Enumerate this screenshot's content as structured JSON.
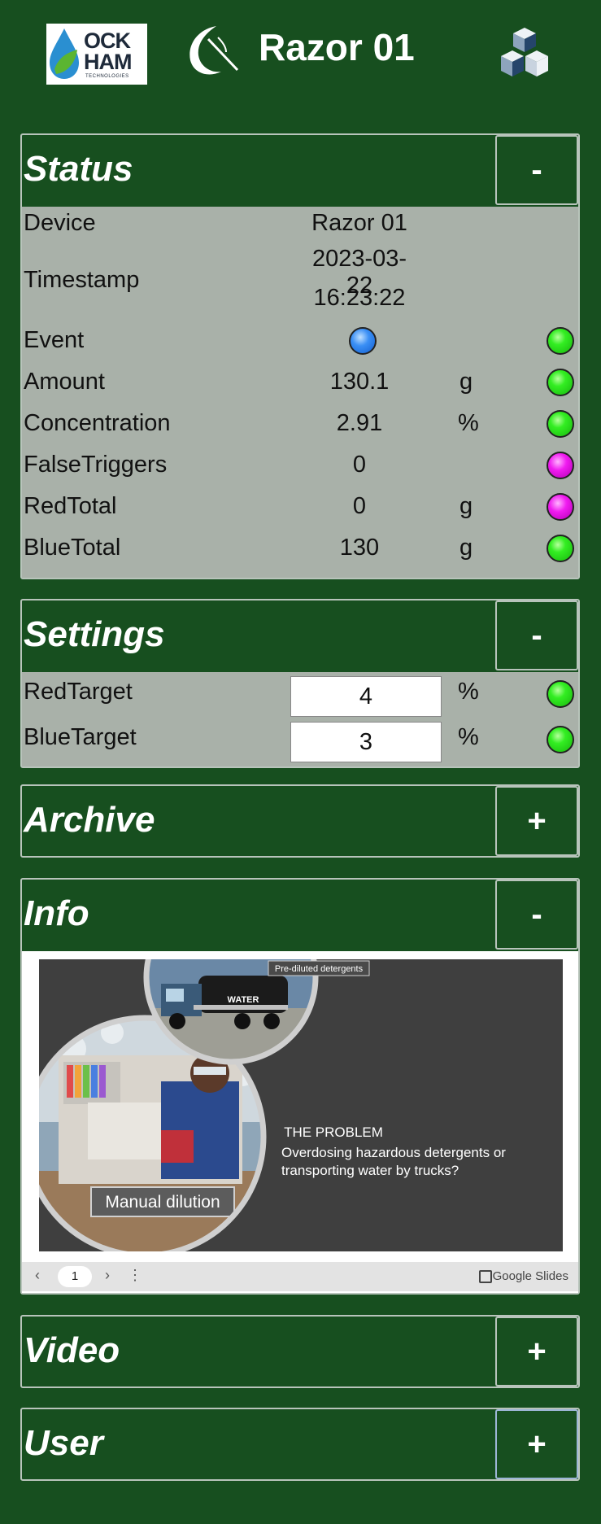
{
  "header": {
    "brand_line1": "OCK",
    "brand_line2": "HAM",
    "brand_sub": "TECHNOLOGIES",
    "title": "Razor 01"
  },
  "status": {
    "title": "Status",
    "toggle": "-",
    "rows": [
      {
        "label": "Device",
        "value": "Razor 01",
        "unit": "",
        "indicator": ""
      },
      {
        "label": "Timestamp",
        "value_line1": "2023-03-22",
        "value_line2": "16:23:22"
      },
      {
        "label": "Event",
        "value_indicator": "blue",
        "indicator": "green"
      },
      {
        "label": "Amount",
        "value": "130.1",
        "unit": "g",
        "indicator": "green"
      },
      {
        "label": "Concentration",
        "value": "2.91",
        "unit": "%",
        "indicator": "green"
      },
      {
        "label": "FalseTriggers",
        "value": "0",
        "unit": "",
        "indicator": "magenta"
      },
      {
        "label": "RedTotal",
        "value": "0",
        "unit": "g",
        "indicator": "magenta"
      },
      {
        "label": "BlueTotal",
        "value": "130",
        "unit": "g",
        "indicator": "green"
      }
    ]
  },
  "settings": {
    "title": "Settings",
    "toggle": "-",
    "rows": [
      {
        "label": "RedTarget",
        "value": "4",
        "unit": "%",
        "indicator": "green"
      },
      {
        "label": "BlueTarget",
        "value": "3",
        "unit": "%",
        "indicator": "green"
      }
    ]
  },
  "archive": {
    "title": "Archive",
    "toggle": "+"
  },
  "info": {
    "title": "Info",
    "toggle": "-",
    "slide": {
      "tag_top": "Pre-diluted detergents",
      "truck_label": "WATER",
      "heading": "THE PROBLEM",
      "text_line1": "Overdosing hazardous detergents or",
      "text_line2": "transporting water by trucks?",
      "caption": "Manual dilution"
    },
    "slides_bar": {
      "page": "1",
      "brand": "Google Slides"
    }
  },
  "video": {
    "title": "Video",
    "toggle": "+"
  },
  "user": {
    "title": "User",
    "toggle": "+"
  },
  "colors": {
    "background": "#174f1f",
    "panel_body": "#a9b1a9",
    "indicator_green": "#33ee22",
    "indicator_blue": "#3a8ff5",
    "indicator_magenta": "#f01bf0"
  }
}
